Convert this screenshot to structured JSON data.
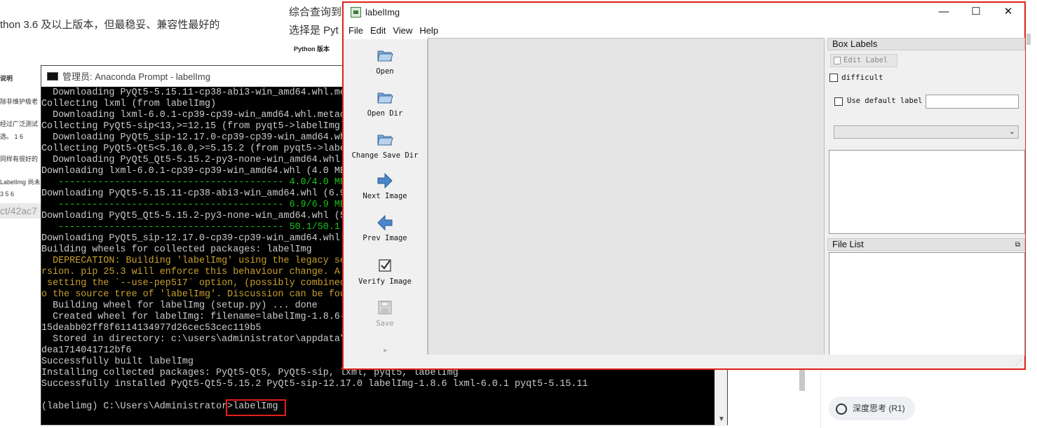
{
  "background_page": {
    "left_text": "thon 3.6 及以上版本，但最稳妥、兼容性最好的",
    "mid_text_1": "综合查询到",
    "mid_text_2": "选择是 Pyt",
    "python_label": "Python 版本",
    "side_items": [
      "说明",
      "除非维护极老",
      "经过广泛测试",
      "选。 1 6",
      "同样有很好的",
      "LabelImg 尚未",
      "3 5 6"
    ],
    "url_fragment": "ct/42ac7",
    "deep_think": "深度思考 (R1)"
  },
  "console": {
    "title": "管理员: Anaconda Prompt - labelImg",
    "lines": [
      {
        "text": "  Downloading PyQt5-5.15.11-cp38-abi3-win_amd64.whl.me",
        "cls": ""
      },
      {
        "text": "Collecting lxml (from labelImg)",
        "cls": ""
      },
      {
        "text": "  Downloading lxml-6.0.1-cp39-cp39-win_amd64.whl.metac",
        "cls": ""
      },
      {
        "text": "Collecting PyQt5-sip<13,>=12.15 (from pyqt5->labelImg)",
        "cls": ""
      },
      {
        "text": "  Downloading PyQt5_sip-12.17.0-cp39-cp39-win_amd64.wh",
        "cls": ""
      },
      {
        "text": "Collecting PyQt5-Qt5<5.16.0,>=5.15.2 (from pyqt5->labe",
        "cls": ""
      },
      {
        "text": "  Downloading PyQt5_Qt5-5.15.2-py3-none-win_amd64.whl.",
        "cls": ""
      },
      {
        "text": "Downloading lxml-6.0.1-cp39-cp39-win_amd64.whl (4.0 ME",
        "cls": ""
      },
      {
        "text": "   ---------------------------------------- 4.0/4.0 ME",
        "cls": "grn"
      },
      {
        "text": "Downloading PyQt5-5.15.11-cp38-abi3-win_amd64.whl (6.9",
        "cls": ""
      },
      {
        "text": "   ---------------------------------------- 6.9/6.9 ME",
        "cls": "grn"
      },
      {
        "text": "Downloading PyQt5_Qt5-5.15.2-py3-none-win_amd64.whl (5",
        "cls": ""
      },
      {
        "text": "   ---------------------------------------- 50.1/50.1",
        "cls": "grn"
      },
      {
        "text": "Downloading PyQt5_sip-12.17.0-cp39-cp39-win_amd64.whl",
        "cls": ""
      },
      {
        "text": "Building wheels for collected packages: labelImg",
        "cls": ""
      },
      {
        "text": "  DEPRECATION: Building 'labelImg' using the legacy se",
        "cls": "yel"
      },
      {
        "text": "rsion. pip 25.3 will enforce this behaviour change. A",
        "cls": "yel"
      },
      {
        "text": " setting the `--use-pep517` option, (possibly combinec",
        "cls": "yel"
      },
      {
        "text": "o the source tree of 'labelImg'. Discussion can be fou",
        "cls": "yel"
      },
      {
        "text": "  Building wheel for labelImg (setup.py) ... done",
        "cls": ""
      },
      {
        "text": "  Created wheel for labelImg: filename=labelImg-1.8.6-",
        "cls": ""
      },
      {
        "text": "15deabb02ff8f6114134977d26cec53cec119b5",
        "cls": ""
      },
      {
        "text": "  Stored in directory: c:\\users\\administrator\\appdata\\",
        "cls": ""
      },
      {
        "text": "dea1714041712bf6",
        "cls": ""
      },
      {
        "text": "Successfully built labelImg",
        "cls": ""
      },
      {
        "text": "Installing collected packages: PyQt5-Qt5, PyQt5-sip, lxml, pyqt5, labelImg",
        "cls": ""
      },
      {
        "text": "Successfully installed PyQt5-Qt5-5.15.2 PyQt5-sip-12.17.0 labelImg-1.8.6 lxml-6.0.1 pyqt5-5.15.11",
        "cls": ""
      },
      {
        "text": "",
        "cls": ""
      },
      {
        "text": "(labelimg) C:\\Users\\Administrator>labelImg",
        "cls": ""
      }
    ]
  },
  "labelimg": {
    "title": "labelImg",
    "window_controls": {
      "minimize": "—",
      "maximize": "☐",
      "close": "✕"
    },
    "menu": [
      "File",
      "Edit",
      "View",
      "Help"
    ],
    "tools": [
      {
        "label": "Open",
        "icon": "folder-icon"
      },
      {
        "label": "Open Dir",
        "icon": "folder-icon"
      },
      {
        "label": "Change Save Dir",
        "icon": "folder-icon"
      },
      {
        "label": "Next Image",
        "icon": "arrow-right-icon"
      },
      {
        "label": "Prev Image",
        "icon": "arrow-left-icon"
      },
      {
        "label": "Verify Image",
        "icon": "checkbox-icon"
      },
      {
        "label": "Save",
        "icon": "save-icon"
      }
    ],
    "more_tools": "»",
    "box_labels": {
      "title": "Box Labels",
      "edit_label": "Edit Label",
      "difficult": "difficult",
      "use_default_label": "Use default label",
      "default_label_value": ""
    },
    "file_list": {
      "title": "File List",
      "float_icon": "⧉"
    }
  },
  "colors": {
    "highlight_box": "#e0201a",
    "console_green": "#1bc31b",
    "console_yellow": "#c8a02e"
  }
}
